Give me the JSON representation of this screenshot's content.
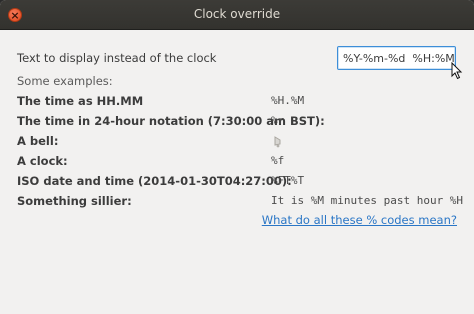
{
  "window": {
    "title": "Clock override",
    "close_glyph": "×"
  },
  "form": {
    "prompt": "Text to display instead of the clock",
    "format_value": "%Y-%m-%d  %H:%M",
    "examples_label": "Some examples:"
  },
  "examples": [
    {
      "description": "The time as HH.MM",
      "code": "%H.%M"
    },
    {
      "description": "The time in 24-hour notation (7:30:00 am BST):",
      "code": "%r"
    },
    {
      "description": "A bell:",
      "code": "",
      "icon": "bell-icon"
    },
    {
      "description": "A clock:",
      "code": "%f"
    },
    {
      "description": "ISO date and time (2014-01-30T04:27:00):",
      "code": "%FT%T"
    },
    {
      "description": "Something sillier:",
      "code": "It is %M minutes past hour %H"
    }
  ],
  "help": {
    "link_text": "What do all these % codes mean?"
  },
  "colors": {
    "accent": "#3d8ed8",
    "link": "#2a76c6",
    "close_button": "#e0451a",
    "titlebar": "#3c3b37"
  }
}
